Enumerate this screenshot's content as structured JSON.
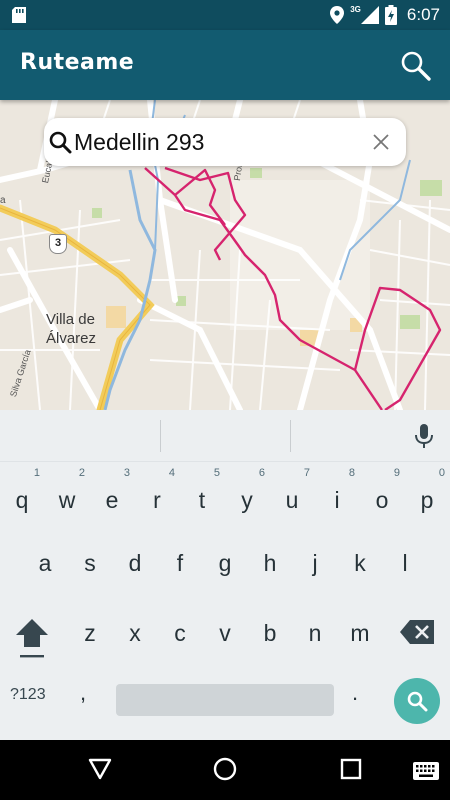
{
  "status_bar": {
    "network": "3G",
    "time": "6:07",
    "icons": [
      "sd-card-icon",
      "location-icon",
      "signal-icon",
      "battery-icon"
    ]
  },
  "app_bar": {
    "title": "Ruteame",
    "search_icon": "search-icon"
  },
  "search": {
    "value": "Medellin 293",
    "clear_icon": "close-icon"
  },
  "map": {
    "labels": {
      "villa": "Villa de\nÁlvarez",
      "eucalipto": "Eucalipto",
      "hidalgo": "Prol. Hidal",
      "silva": "Silva García",
      "edge_a": "a",
      "route_shield": "3"
    },
    "colors": {
      "route": "#D6246E",
      "river": "#8FB8DE",
      "highway": "#F2CC5A",
      "road": "#FFFFFF",
      "park": "#C6DDA8"
    }
  },
  "keyboard": {
    "row1": [
      {
        "key": "q",
        "hint": "1"
      },
      {
        "key": "w",
        "hint": "2"
      },
      {
        "key": "e",
        "hint": "3"
      },
      {
        "key": "r",
        "hint": "4"
      },
      {
        "key": "t",
        "hint": "5"
      },
      {
        "key": "y",
        "hint": "6"
      },
      {
        "key": "u",
        "hint": "7"
      },
      {
        "key": "i",
        "hint": "8"
      },
      {
        "key": "o",
        "hint": "9"
      },
      {
        "key": "p",
        "hint": "0"
      }
    ],
    "row2": [
      "a",
      "s",
      "d",
      "f",
      "g",
      "h",
      "j",
      "k",
      "l"
    ],
    "row3": [
      "z",
      "x",
      "c",
      "v",
      "b",
      "n",
      "m"
    ],
    "symbols_label": "?123",
    "comma": ",",
    "period": "."
  },
  "nav_bar": {
    "icons": [
      "back-icon",
      "home-icon",
      "recents-icon",
      "keyboard-switch-icon"
    ]
  }
}
